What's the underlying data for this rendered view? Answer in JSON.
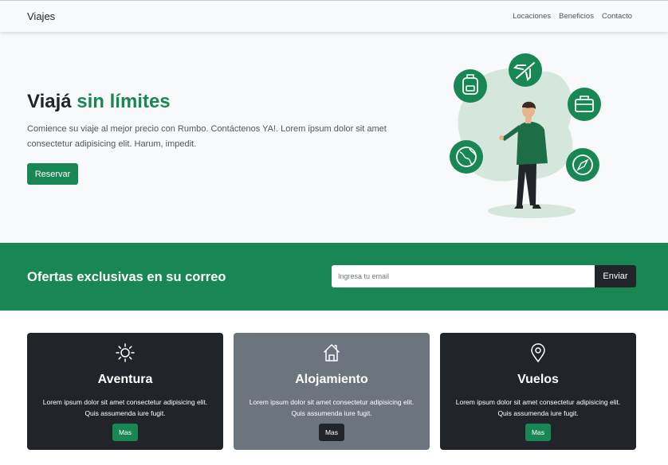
{
  "navbar": {
    "brand": "Viajes",
    "links": [
      "Locaciones",
      "Beneficios",
      "Contacto"
    ]
  },
  "hero": {
    "title_main": "Viajá",
    "title_accent": "sin límites",
    "description": "Comience su viaje al mejor precio con Rumbo. Contáctenos YA!. Lorem ipsum dolor sit amet consectetur adipisicing elit. Harum, impedit.",
    "button_label": "Reservar"
  },
  "newsletter": {
    "heading": "Ofertas exclusivas en su correo",
    "email_placeholder": "Ingresa tu email",
    "email_value": "",
    "button_label": "Enviar"
  },
  "cards": [
    {
      "icon": "sun-icon",
      "title": "Aventura",
      "description": "Lorem ipsum dolor sit amet consectetur adipisicing elit. Quis assumenda iure fugit.",
      "button_label": "Mas"
    },
    {
      "icon": "house-icon",
      "title": "Alojamiento",
      "description": "Lorem ipsum dolor sit amet consectetur adipisicing elit. Quis assumenda iure fugit.",
      "button_label": "Mas"
    },
    {
      "icon": "map-pin-icon",
      "title": "Vuelos",
      "description": "Lorem ipsum dolor sit amet consectetur adipisicing elit. Quis assumenda iure fugit.",
      "button_label": "Mas"
    }
  ],
  "colors": {
    "accent": "#198754",
    "dark": "#212529",
    "gray": "#6c757d",
    "light": "#f8f9fa"
  }
}
